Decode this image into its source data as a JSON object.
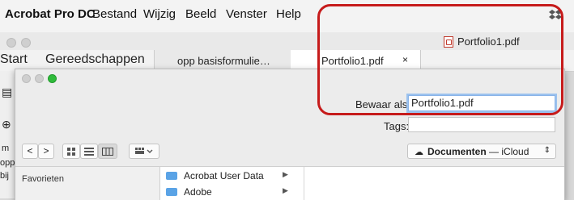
{
  "menubar": {
    "app_name": "Acrobat Pro DC",
    "items": [
      "Bestand",
      "Wijzig",
      "Beeld",
      "Venster",
      "Help"
    ]
  },
  "document": {
    "title": "Portfolio1.pdf"
  },
  "tabs": {
    "start": "Start",
    "tools": "Gereedschappen",
    "open_docs": [
      {
        "label": "opp basisformulie…"
      },
      {
        "label": "Portfolio1.pdf",
        "close": "×"
      }
    ]
  },
  "left_strip": {
    "labels": [
      "m",
      "opp",
      "bij"
    ]
  },
  "save_dialog": {
    "save_as_label": "Bewaar als:",
    "save_as_value": "Portfolio1.pdf",
    "tags_label": "Tags:",
    "tags_value": "",
    "nav_back": "<",
    "nav_forward": ">",
    "location": {
      "name": "Documenten",
      "separator": "—",
      "service": "iCloud"
    },
    "sidebar": {
      "heading": "Favorieten"
    },
    "files": [
      {
        "name": "Acrobat User Data"
      },
      {
        "name": "Adobe"
      }
    ]
  },
  "colors": {
    "highlight": "#c61b1b",
    "folder": "#5aa3e6",
    "focus": "#8ab4e9"
  }
}
